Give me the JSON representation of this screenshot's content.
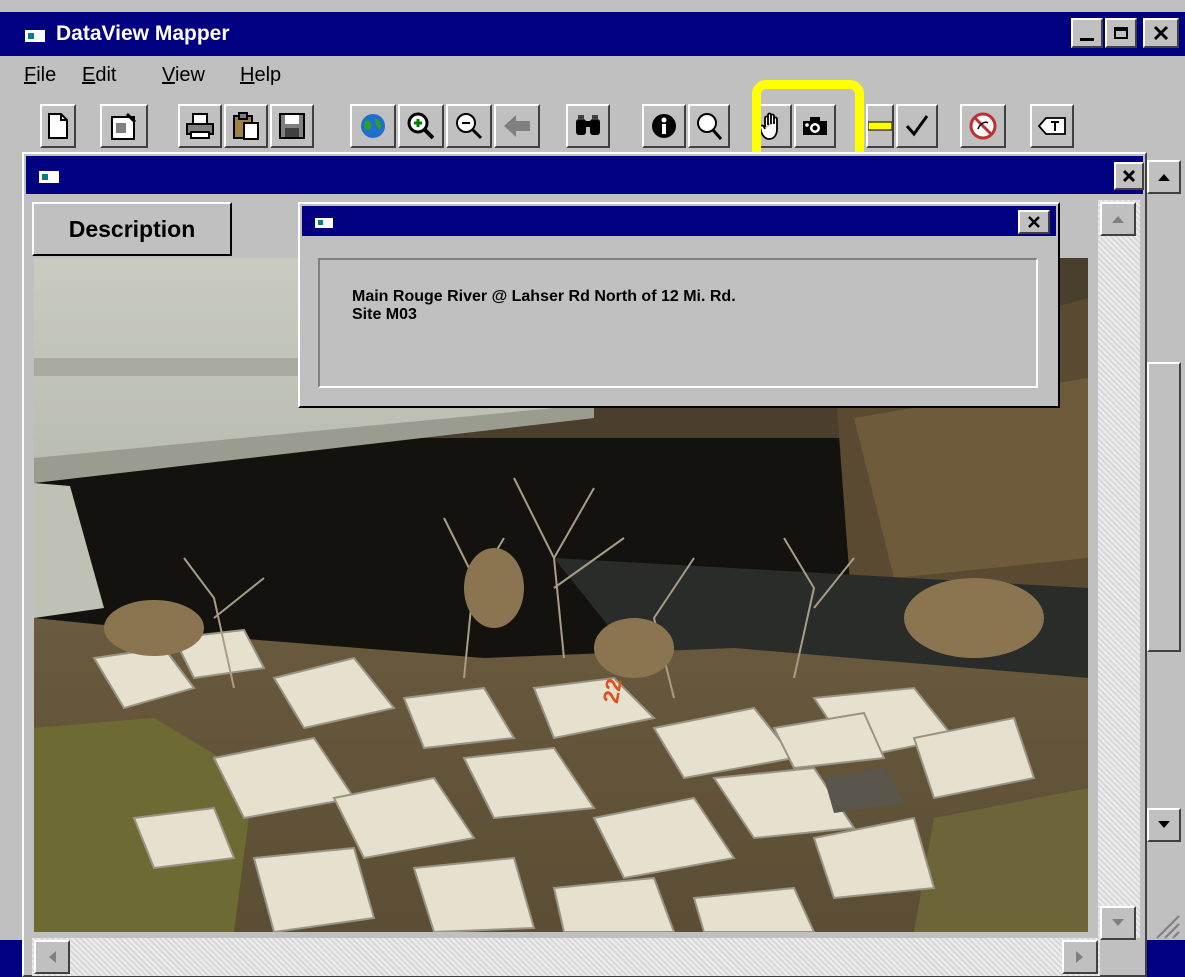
{
  "app": {
    "title": "DataView Mapper",
    "menu": [
      "File",
      "Edit",
      "View",
      "Help"
    ],
    "menu_accel": [
      "F",
      "E",
      "V",
      "H"
    ],
    "menu_rest": [
      "ile",
      "dit",
      "iew",
      "elp"
    ]
  },
  "toolbar": {
    "highlight_color": "#ffff00",
    "buttons": [
      "new-document",
      "properties",
      "print",
      "paste",
      "save",
      "globe",
      "zoom-in",
      "zoom-out",
      "back",
      "find",
      "info",
      "search",
      "pan-hand",
      "photo-camera",
      "measure-ruler",
      "check",
      "no-selection",
      "text-label"
    ]
  },
  "child_window": {
    "title": "",
    "description_button": "Description"
  },
  "popup": {
    "title": "",
    "line1": "Main Rouge River @ Lahser Rd North of 12 Mi. Rd.",
    "line2": "Site M03"
  },
  "photo": {
    "subject": "river-bridge-rocks-photo",
    "marker_text": "22"
  },
  "colors": {
    "titlebar": "#000080",
    "chrome": "#c0c0c0",
    "background": "#0a1170"
  }
}
